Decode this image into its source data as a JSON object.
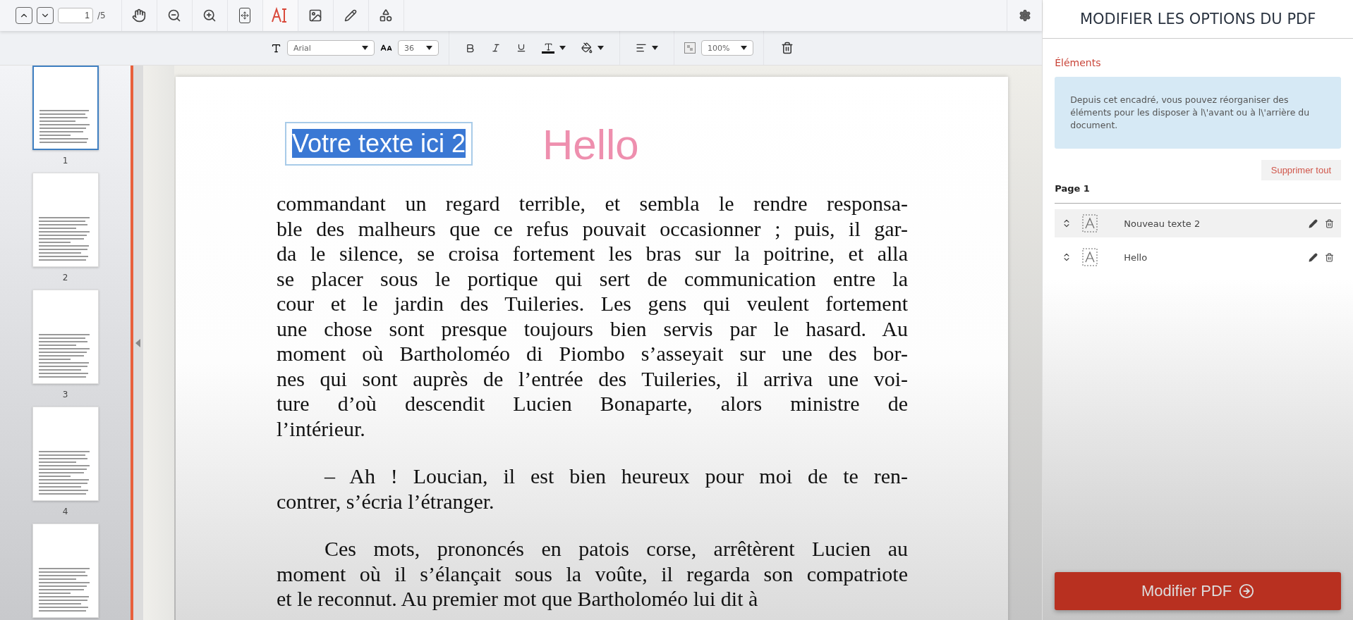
{
  "pager": {
    "page": "1",
    "total": "/5"
  },
  "tools": [
    {
      "kind": "hand",
      "selected": false
    },
    {
      "kind": "zoom-out",
      "selected": false
    },
    {
      "kind": "zoom-in",
      "selected": false
    },
    {
      "kind": "fit",
      "selected": false
    },
    {
      "kind": "text",
      "selected": true
    },
    {
      "kind": "image",
      "selected": false
    },
    {
      "kind": "pen",
      "selected": false
    },
    {
      "kind": "shapes",
      "selected": false
    }
  ],
  "format_bar": {
    "font": "Arial",
    "size": "36",
    "opacity": "100%"
  },
  "thumbnails": [
    {
      "label": "1",
      "selected": true
    },
    {
      "label": "2",
      "selected": false
    },
    {
      "label": "3",
      "selected": false
    },
    {
      "label": "4",
      "selected": false
    },
    {
      "selected": false
    }
  ],
  "page_overlays": [
    {
      "kind": "textbox",
      "text": "Votre texte ici 2",
      "selected": true
    },
    {
      "kind": "text",
      "text": "Hello"
    }
  ],
  "paragraphs": [
    {
      "indent": false,
      "lines": [
        "commandant un regard terrible, et sembla le rendre responsa-",
        "ble des malheurs que ce refus pouvait occasionner ; puis, il gar-",
        "da le silence, se croisa fortement les bras sur la poitrine, et alla",
        "se placer sous le portique qui sert de communication entre la",
        "cour et le jardin des Tuileries. Les gens qui veulent fortement",
        "une chose sont presque toujours bien servis par le hasard. Au",
        "moment où Bartholoméo di Piombo s’asseyait sur une des bor-",
        "nes qui sont auprès de l’entrée des Tuileries, il arriva une voi-",
        "ture d’où descendit Lucien Bonaparte, alors ministre de",
        "l’intérieur."
      ]
    },
    {
      "indent": true,
      "lines": [
        "– Ah ! Loucian, il est bien heureux pour moi de te ren-",
        "contrer, s’écria l’étranger."
      ]
    },
    {
      "indent": true,
      "lines": [
        "Ces mots, prononcés en patois corse, arrêtèrent Lucien au",
        "moment où il s’élançait sous la voûte, il regarda son compatriote",
        "et le reconnut. Au premier mot que Bartholoméo lui dit à"
      ]
    }
  ],
  "panel": {
    "title": "MODIFIER LES OPTIONS DU PDF",
    "section": "Éléments",
    "info": "Depuis cet encadré, vous pouvez réorganiser des éléments pour les disposer à l\\'avant ou à l\\'arrière du document.",
    "clear_button": "Supprimer tout",
    "page_label": "Page 1",
    "items": [
      {
        "name": "Nouveau texte 2",
        "selected": true
      },
      {
        "name": "Hello",
        "selected": false
      }
    ],
    "submit": "Modifier PDF"
  }
}
